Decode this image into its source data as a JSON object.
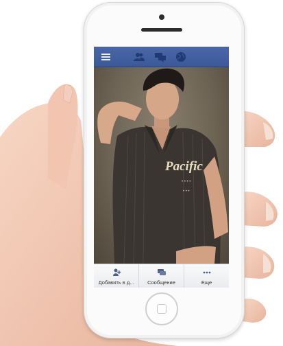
{
  "colors": {
    "brand_blue": "#3b5998",
    "screen_bg": "#000000",
    "phone_body": "#fbfbfb"
  },
  "topbar": {
    "icons": [
      "menu-icon",
      "friends-icon",
      "messages-icon",
      "globe-icon"
    ]
  },
  "photo": {
    "shirt_print": "Pacific"
  },
  "actions": [
    {
      "icon": "add-friend-icon",
      "label": "Добавить в д..."
    },
    {
      "icon": "message-icon",
      "label": "Сообщение"
    },
    {
      "icon": "more-icon",
      "label": "Еще"
    }
  ]
}
